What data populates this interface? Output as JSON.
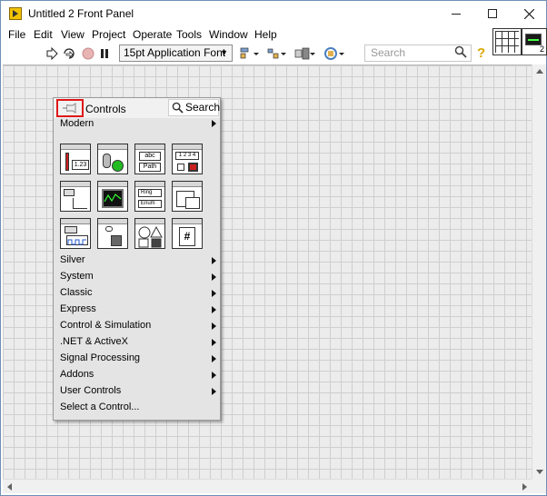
{
  "window": {
    "title": "Untitled 2 Front Panel"
  },
  "menubar": {
    "items": [
      "File",
      "Edit",
      "View",
      "Project",
      "Operate",
      "Tools",
      "Window",
      "Help"
    ]
  },
  "toolbar": {
    "font_select": "15pt Application Font",
    "search_placeholder": "Search",
    "help_icon": "?"
  },
  "vi_icon": {
    "number": "2"
  },
  "palette": {
    "title": "Controls",
    "search_label": "Search",
    "current_category": "Modern",
    "categories": [
      {
        "label": "Silver",
        "has_submenu": true
      },
      {
        "label": "System",
        "has_submenu": true
      },
      {
        "label": "Classic",
        "has_submenu": true
      },
      {
        "label": "Express",
        "has_submenu": true
      },
      {
        "label": "Control & Simulation",
        "has_submenu": true
      },
      {
        "label": ".NET & ActiveX",
        "has_submenu": true
      },
      {
        "label": "Signal Processing",
        "has_submenu": true
      },
      {
        "label": "Addons",
        "has_submenu": true
      },
      {
        "label": "User Controls",
        "has_submenu": true
      },
      {
        "label": "Select a Control...",
        "has_submenu": false
      }
    ],
    "tiles": {
      "numeric": "1.23",
      "string_top": "abc",
      "string_bottom": "Path",
      "array_digits": "1 2 3 4",
      "ring_top": "Ring",
      "ring_bottom": "Enum",
      "refnum": "#"
    }
  },
  "colors": {
    "highlight_border": "#e01818",
    "canvas_bg": "#ececec",
    "palette_bg": "#e4e4e4"
  }
}
